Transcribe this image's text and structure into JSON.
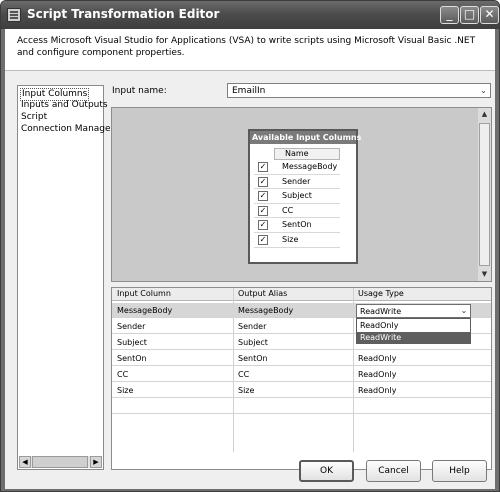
{
  "window": {
    "title": "Script Transformation Editor",
    "controls": {
      "minimize": "_",
      "maximize": "□",
      "close": "✕"
    }
  },
  "description": "Access Microsoft Visual Studio for Applications (VSA) to write scripts using Microsoft Visual Basic .NET and configure component properties.",
  "nav": {
    "items": [
      {
        "label": "Input Columns",
        "selected": true
      },
      {
        "label": "Inputs and Outputs",
        "selected": false
      },
      {
        "label": "Script",
        "selected": false
      },
      {
        "label": "Connection Managers",
        "selected": false
      }
    ],
    "scroll_left": "◀",
    "scroll_right": "▶"
  },
  "input_name": {
    "label": "Input name:",
    "value": "EmailIn"
  },
  "available_columns": {
    "title": "Available Input Columns",
    "header": "Name",
    "items": [
      {
        "name": "MessageBody",
        "checked": true
      },
      {
        "name": "Sender",
        "checked": true
      },
      {
        "name": "Subject",
        "checked": true
      },
      {
        "name": "CC",
        "checked": true
      },
      {
        "name": "SentOn",
        "checked": true
      },
      {
        "name": "Size",
        "checked": true
      }
    ]
  },
  "grid": {
    "headers": [
      "Input Column",
      "Output Alias",
      "Usage Type"
    ],
    "rows": [
      {
        "input": "MessageBody",
        "alias": "MessageBody",
        "usage": "ReadWrite"
      },
      {
        "input": "Sender",
        "alias": "Sender",
        "usage": "ReadOnly"
      },
      {
        "input": "Subject",
        "alias": "Subject",
        "usage": "ReadWrite"
      },
      {
        "input": "SentOn",
        "alias": "SentOn",
        "usage": "ReadOnly"
      },
      {
        "input": "CC",
        "alias": "CC",
        "usage": "ReadOnly"
      },
      {
        "input": "Size",
        "alias": "Size",
        "usage": "ReadOnly"
      }
    ],
    "dropdown_options": [
      "ReadOnly",
      "ReadWrite"
    ],
    "dropdown_highlighted": "ReadWrite"
  },
  "buttons": {
    "ok": "OK",
    "cancel": "Cancel",
    "help": "Help"
  },
  "glyphs": {
    "check": "✓",
    "combo_arrow": "⌄",
    "scroll_up": "▲",
    "scroll_down": "▼"
  }
}
